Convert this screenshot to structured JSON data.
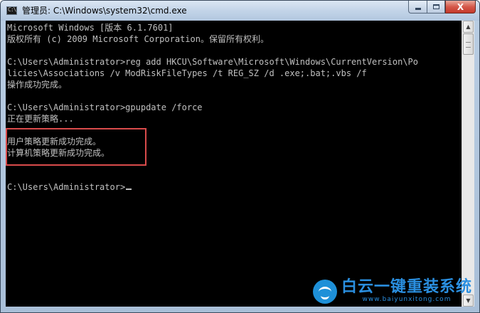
{
  "window": {
    "title": "管理员: C:\\Windows\\system32\\cmd.exe",
    "app_icon_text": "C:\\",
    "buttons": {
      "minimize_icon": "minimize-icon",
      "maximize_icon": "maximize-icon",
      "close_label": "X"
    }
  },
  "console": {
    "lines": [
      "Microsoft Windows [版本 6.1.7601]",
      "版权所有 (c) 2009 Microsoft Corporation。保留所有权利。",
      "",
      "C:\\Users\\Administrator>reg add HKCU\\Software\\Microsoft\\Windows\\CurrentVersion\\Po",
      "licies\\Associations /v ModRiskFileTypes /t REG_SZ /d .exe;.bat;.vbs /f",
      "操作成功完成。",
      "",
      "C:\\Users\\Administrator>gpupdate /force",
      "正在更新策略...",
      "",
      "用户策略更新成功完成。",
      "计算机策略更新成功完成。",
      "",
      "",
      "C:\\Users\\Administrator>"
    ],
    "text_color": "#c0c0c0",
    "background_color": "#000000",
    "highlight_color": "#d94b4b"
  },
  "scrollbar": {
    "up_arrow": "▲",
    "down_arrow": "▼"
  },
  "watermark": {
    "title": "白云一键重装系统",
    "url": "www.baiyunxitong.com",
    "color": "#2a8fe0"
  }
}
